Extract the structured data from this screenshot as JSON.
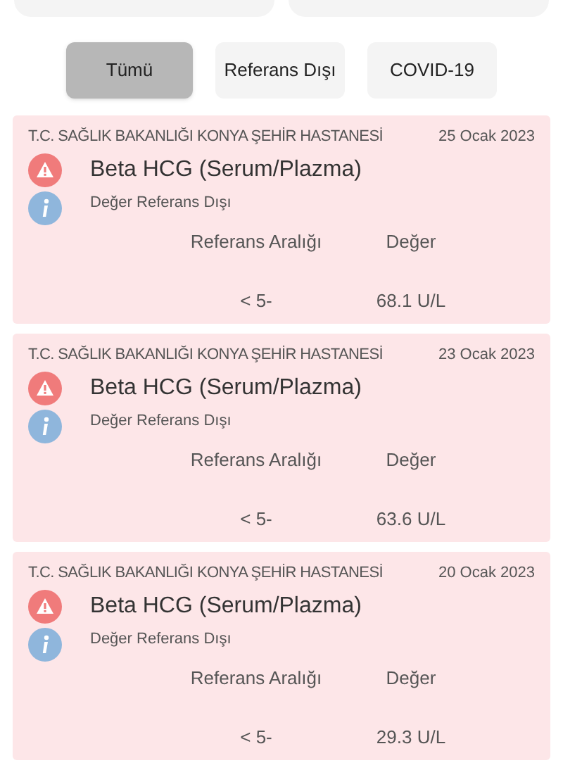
{
  "filters": [
    {
      "label": "Tümü",
      "selected": true
    },
    {
      "label": "Referans Dışı",
      "selected": false
    },
    {
      "label": "COVID-19",
      "selected": false
    }
  ],
  "results": [
    {
      "hospital": "T.C. SAĞLIK BAKANLIĞI KONYA ŞEHİR HASTANESİ",
      "date": "25 Ocak 2023",
      "test": "Beta HCG (Serum/Plazma)",
      "status": "Değer Referans Dışı",
      "range_label": "Referans Aralığı",
      "value_label": "Değer",
      "range": "< 5-",
      "value": "68.1 U/L"
    },
    {
      "hospital": "T.C. SAĞLIK BAKANLIĞI KONYA ŞEHİR HASTANESİ",
      "date": "23 Ocak 2023",
      "test": "Beta HCG (Serum/Plazma)",
      "status": "Değer Referans Dışı",
      "range_label": "Referans Aralığı",
      "value_label": "Değer",
      "range": "< 5-",
      "value": "63.6 U/L"
    },
    {
      "hospital": "T.C. SAĞLIK BAKANLIĞI KONYA ŞEHİR HASTANESİ",
      "date": "20 Ocak 2023",
      "test": "Beta HCG (Serum/Plazma)",
      "status": "Değer Referans Dışı",
      "range_label": "Referans Aralığı",
      "value_label": "Değer",
      "range": "< 5-",
      "value": "29.3 U/L"
    }
  ]
}
